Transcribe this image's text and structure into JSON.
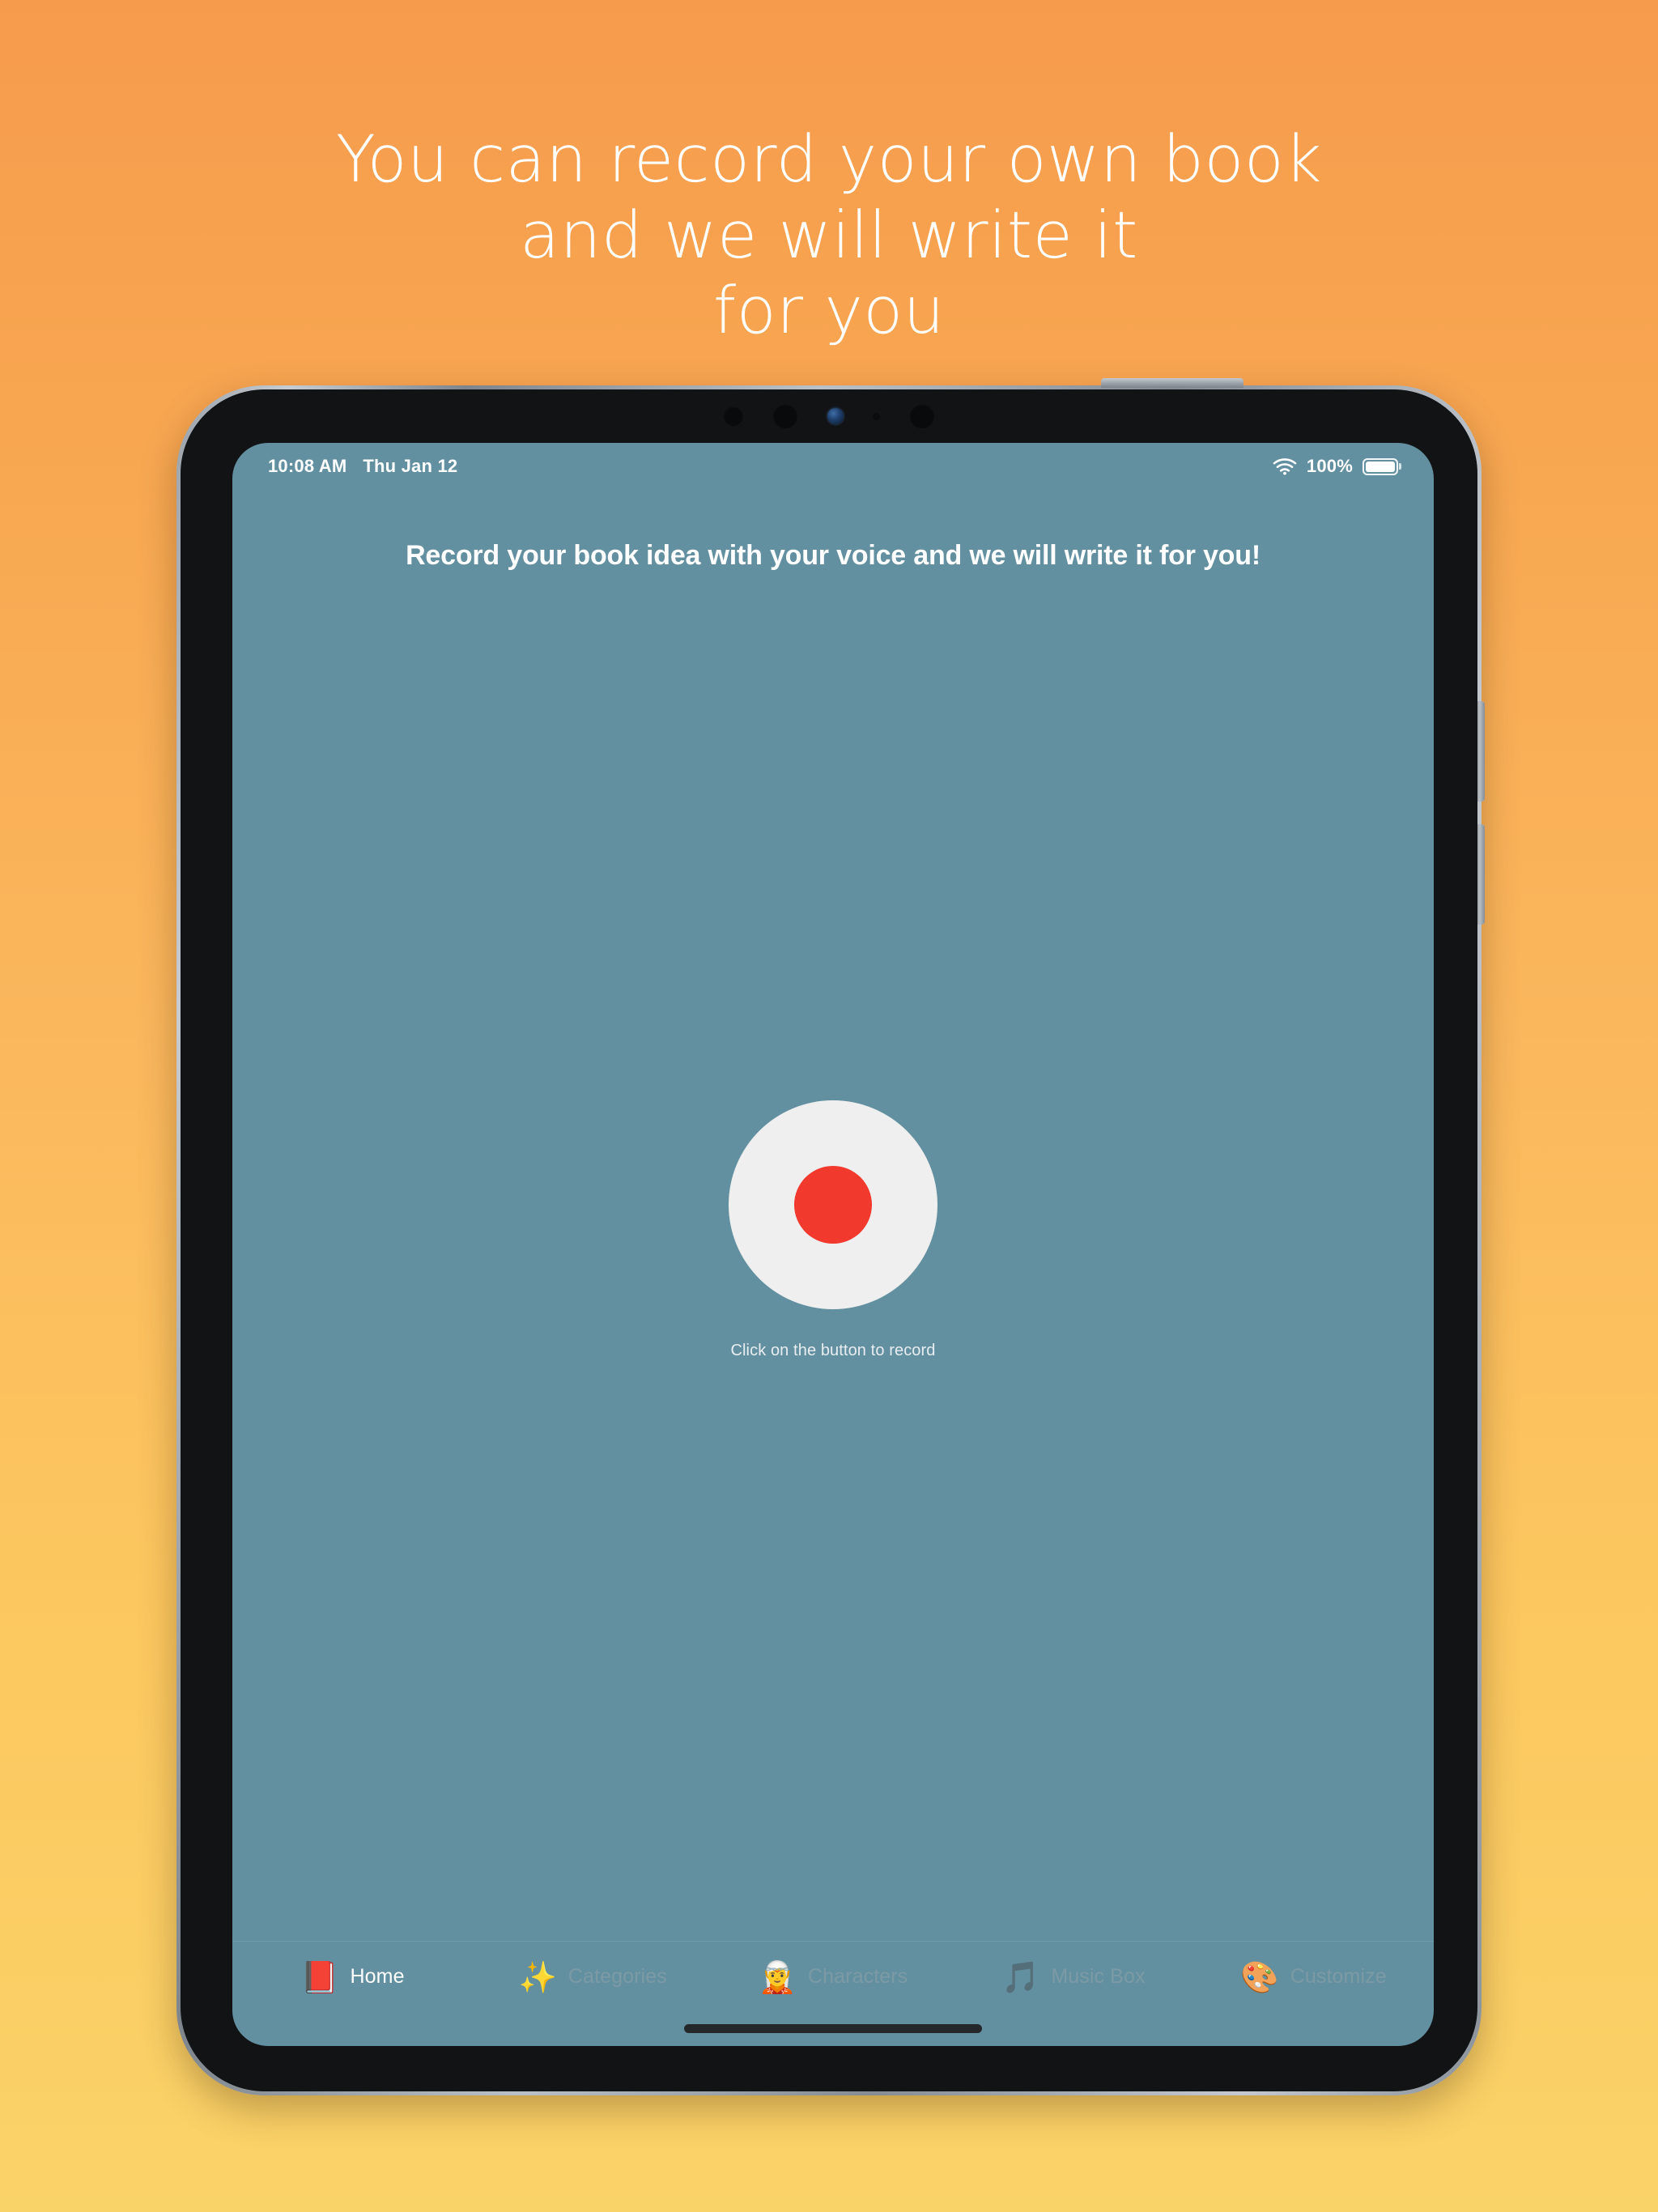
{
  "marketing": {
    "headline": "You can record your own book\nand we will write it\nfor you",
    "background_top_color": "#F69B4C",
    "background_bottom_color": "#FAD368",
    "headline_color": "#FFFFFF"
  },
  "device": {
    "type": "tablet",
    "frame_color": "#9AA1A8",
    "body_color": "#111315",
    "hardware": {
      "power_button": "power-button",
      "volume_up_button": "volume-up-button",
      "volume_down_button": "volume-down-button",
      "camera_cluster": "camera-cluster"
    }
  },
  "status_bar": {
    "time": "10:08 AM",
    "date": "Thu Jan 12",
    "wifi_icon": "wifi-icon",
    "battery_percent": "100%",
    "battery_icon": "battery-full-icon"
  },
  "app": {
    "background_color": "#6390A0",
    "title": "Record your book idea with your voice and we will write it for you!",
    "record": {
      "button_name": "record-button",
      "button_color": "#EEEFEE",
      "dot_color": "#F1392E",
      "hint": "Click on the button to record"
    },
    "tab_bar": {
      "active_index": 0,
      "active_color": "#FFFFFF",
      "inactive_color": "#7C9AA6",
      "items": [
        {
          "label": "Home",
          "emoji": "📕",
          "icon": "closed-book-icon",
          "active": true
        },
        {
          "label": "Categories",
          "emoji": "✨",
          "icon": "sparkles-icon",
          "active": false
        },
        {
          "label": "Characters",
          "emoji": "🧝",
          "icon": "elf-icon",
          "active": false
        },
        {
          "label": "Music Box",
          "emoji": "🎵",
          "icon": "music-box-icon",
          "active": false
        },
        {
          "label": "Customize",
          "emoji": "🎨",
          "icon": "color-wheel-icon",
          "active": false
        }
      ]
    },
    "home_indicator": "home-indicator"
  }
}
